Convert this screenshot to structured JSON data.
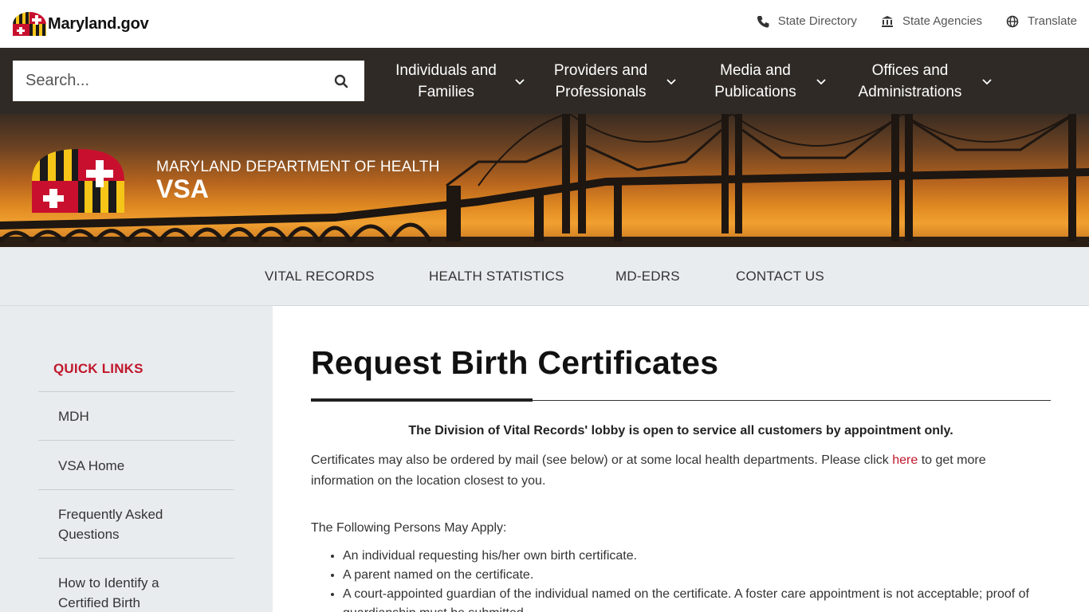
{
  "header": {
    "logo_text": "Maryland.gov",
    "utility_links": [
      {
        "label": "State Directory",
        "icon": "phone-icon"
      },
      {
        "label": "State Agencies",
        "icon": "building-icon"
      },
      {
        "label": "Translate",
        "icon": "globe-icon"
      }
    ]
  },
  "search": {
    "placeholder": "Search..."
  },
  "main_nav": [
    {
      "label": "Individuals and Families"
    },
    {
      "label": "Providers and Professionals"
    },
    {
      "label": "Media and Publications"
    },
    {
      "label": "Offices and Administrations"
    }
  ],
  "hero": {
    "department": "MARYLAND DEPARTMENT OF HEALTH",
    "site_name": "VSA"
  },
  "sub_nav": [
    {
      "label": "VITAL RECORDS"
    },
    {
      "label": "HEALTH STATISTICS"
    },
    {
      "label": "MD-EDRS"
    },
    {
      "label": "CONTACT US"
    }
  ],
  "sidebar": {
    "title": "QUICK LINKS",
    "items": [
      {
        "label": "MDH"
      },
      {
        "label": "VSA Home"
      },
      {
        "label": "Frequently Asked Questions"
      },
      {
        "label": "How to Identify a Certified Birth"
      }
    ]
  },
  "content": {
    "title": "Request Birth Certificates",
    "notice": "The Division of Vital Records' lobby is open to service all customers by appointment only.",
    "para_before_link": "Certificates may also be ordered by mail (see below) or at some local health departments. Please click ",
    "para_link": "here",
    "para_after_link": " to get more information on the location closest to you.",
    "persons_heading": "The Following Persons May Apply:",
    "persons": [
      "An individual requesting his/her own birth certificate.",
      "A parent named on the certificate.",
      "A court-appointed guardian of the individual named on the certificate. A foster care appointment is not acceptable; proof of guardianship must be submitted."
    ]
  },
  "colors": {
    "accent_red": "#c0172c",
    "nav_bg": "#2f2a25",
    "subnav_bg": "#e9ecef",
    "md_yellow": "#f5c518",
    "md_black": "#1a1a1a"
  }
}
